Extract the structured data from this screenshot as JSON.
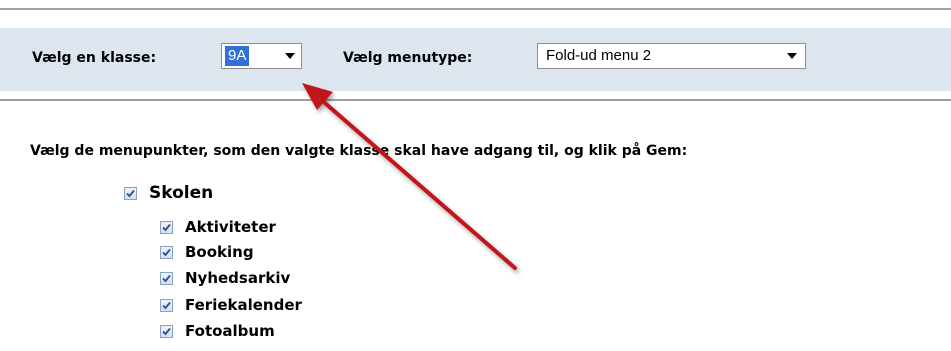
{
  "toolbar": {
    "class_label": "Vælg en klasse:",
    "class_value": "9A",
    "menutype_label": "Vælg menutype:",
    "menutype_value": "Fold-ud menu 2"
  },
  "instruction": "Vælg de menupunkter, som den valgte klasse skal have adgang til, og klik på Gem:",
  "tree": {
    "parent": {
      "label": "Skolen",
      "checked": true
    },
    "children": [
      {
        "label": "Aktiviteter",
        "checked": true
      },
      {
        "label": "Booking",
        "checked": true
      },
      {
        "label": "Nyhedsarkiv",
        "checked": true
      },
      {
        "label": "Feriekalender",
        "checked": true
      },
      {
        "label": "Fotoalbum",
        "checked": true
      }
    ]
  },
  "colors": {
    "toolbar_bg": "#dde6ee",
    "selection": "#3170d8",
    "annotation_arrow": "#c0141c",
    "checkmark": "#2b4f8f"
  },
  "icons": {
    "dropdown": "chevron-down-icon",
    "checkbox": "checkmark-icon",
    "annotation": "red-arrow-icon"
  }
}
